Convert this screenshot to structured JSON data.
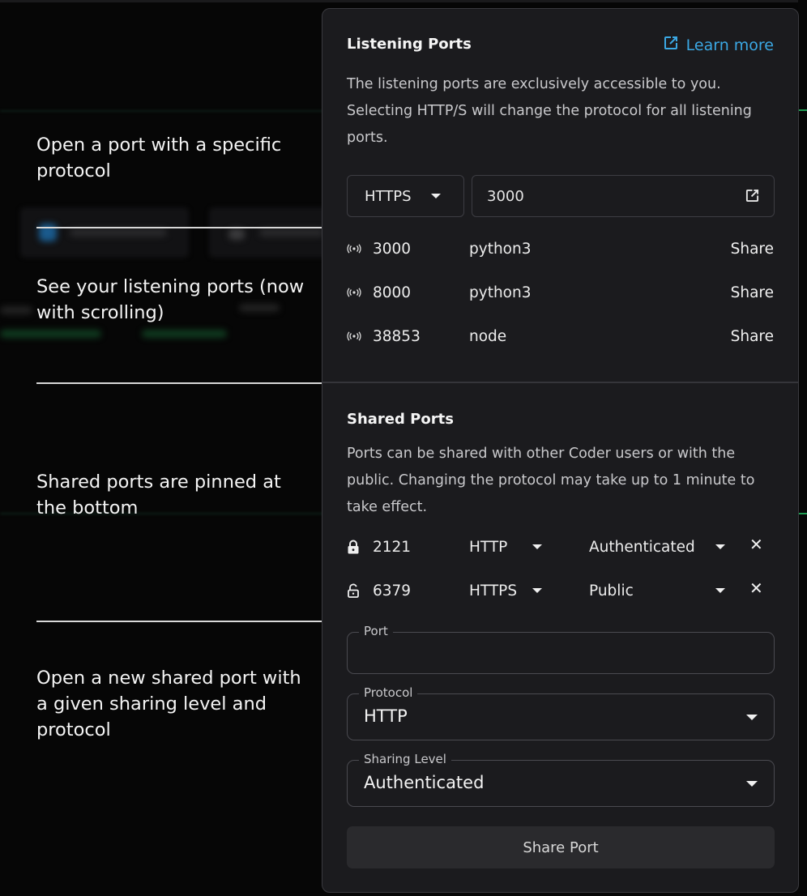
{
  "annotations": [
    "Open a port with a specific protocol",
    "See your listening ports (now with scrolling)",
    "Shared ports are pinned at the bottom",
    "Open a new shared port with a given sharing level and protocol"
  ],
  "listening": {
    "title": "Listening Ports",
    "learn_more": "Learn more",
    "description": "The listening ports are exclusively accessible to you. Selecting HTTP/S will change the protocol for all listening ports.",
    "protocol_select": "HTTPS",
    "port_input_value": "3000",
    "ports": [
      {
        "port": "3000",
        "process": "python3",
        "action": "Share"
      },
      {
        "port": "8000",
        "process": "python3",
        "action": "Share"
      },
      {
        "port": "38853",
        "process": "node",
        "action": "Share"
      }
    ]
  },
  "shared": {
    "title": "Shared Ports",
    "description": "Ports can be shared with other Coder users or with the public. Changing the protocol may take up to 1 minute to take effect.",
    "ports": [
      {
        "port": "2121",
        "protocol": "HTTP",
        "level": "Authenticated",
        "lock": "locked"
      },
      {
        "port": "6379",
        "protocol": "HTTPS",
        "level": "Public",
        "lock": "unlocked"
      }
    ],
    "form": {
      "port_label": "Port",
      "port_value": "",
      "protocol_label": "Protocol",
      "protocol_value": "HTTP",
      "level_label": "Sharing Level",
      "level_value": "Authenticated",
      "submit": "Share Port"
    }
  },
  "colors": {
    "accent_link": "#3ba8e4",
    "panel_bg": "#1b1b1e",
    "page_bg": "#050505"
  }
}
